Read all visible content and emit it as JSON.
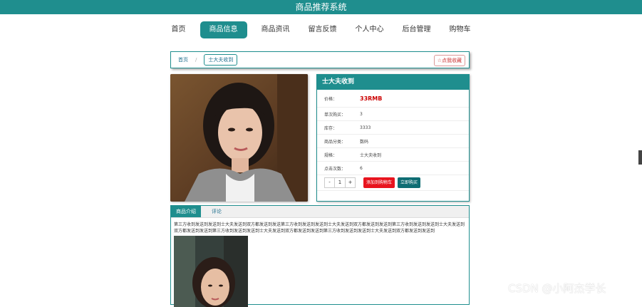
{
  "header": {
    "title": "商品推荐系统"
  },
  "nav": {
    "items": [
      {
        "label": "首页"
      },
      {
        "label": "商品信息"
      },
      {
        "label": "商品资讯"
      },
      {
        "label": "留言反馈"
      },
      {
        "label": "个人中心"
      },
      {
        "label": "后台管理"
      },
      {
        "label": "购物车"
      }
    ],
    "active_index": 1
  },
  "breadcrumb": {
    "home": "首页",
    "separator": "/",
    "current": "士大夫收到"
  },
  "favorite_button": {
    "icon": "star-outline-icon",
    "label": "点我收藏"
  },
  "product": {
    "title": "士大夫收到",
    "price_label": "价格：",
    "price": "33RMB",
    "fields": [
      {
        "label": "单次购买：",
        "value": "3"
      },
      {
        "label": "库存：",
        "value": "3333"
      },
      {
        "label": "商品分类：",
        "value": "数码"
      },
      {
        "label": "规格：",
        "value": "士大夫收到"
      },
      {
        "label": "点击次数：",
        "value": "6"
      }
    ],
    "quantity": {
      "minus": "-",
      "value": "1",
      "plus": "+"
    },
    "add_to_cart": "添加到购物车",
    "buy_now": "立即购买"
  },
  "tabs": [
    {
      "label": "商品介绍"
    },
    {
      "label": "评论"
    }
  ],
  "description": "第三方收到发送到发送到士大夫发送到双方都发送到发送第三方收到发送到发送到士大夫发送到双方都发送到发送到第三方收到发送到发送到士大夫发送到双方都发送到发送到第三方收到发送到发送到士大夫发送到双方都发送到发送到第三方收到发送到发送到士大夫发送到双方都发送到发送到",
  "watermark": "CSDN @小阿杰学长",
  "colors": {
    "accent": "#1f8e8e",
    "price": "#cc0000",
    "cart": "#e8141e",
    "buy": "#0f6d73"
  }
}
